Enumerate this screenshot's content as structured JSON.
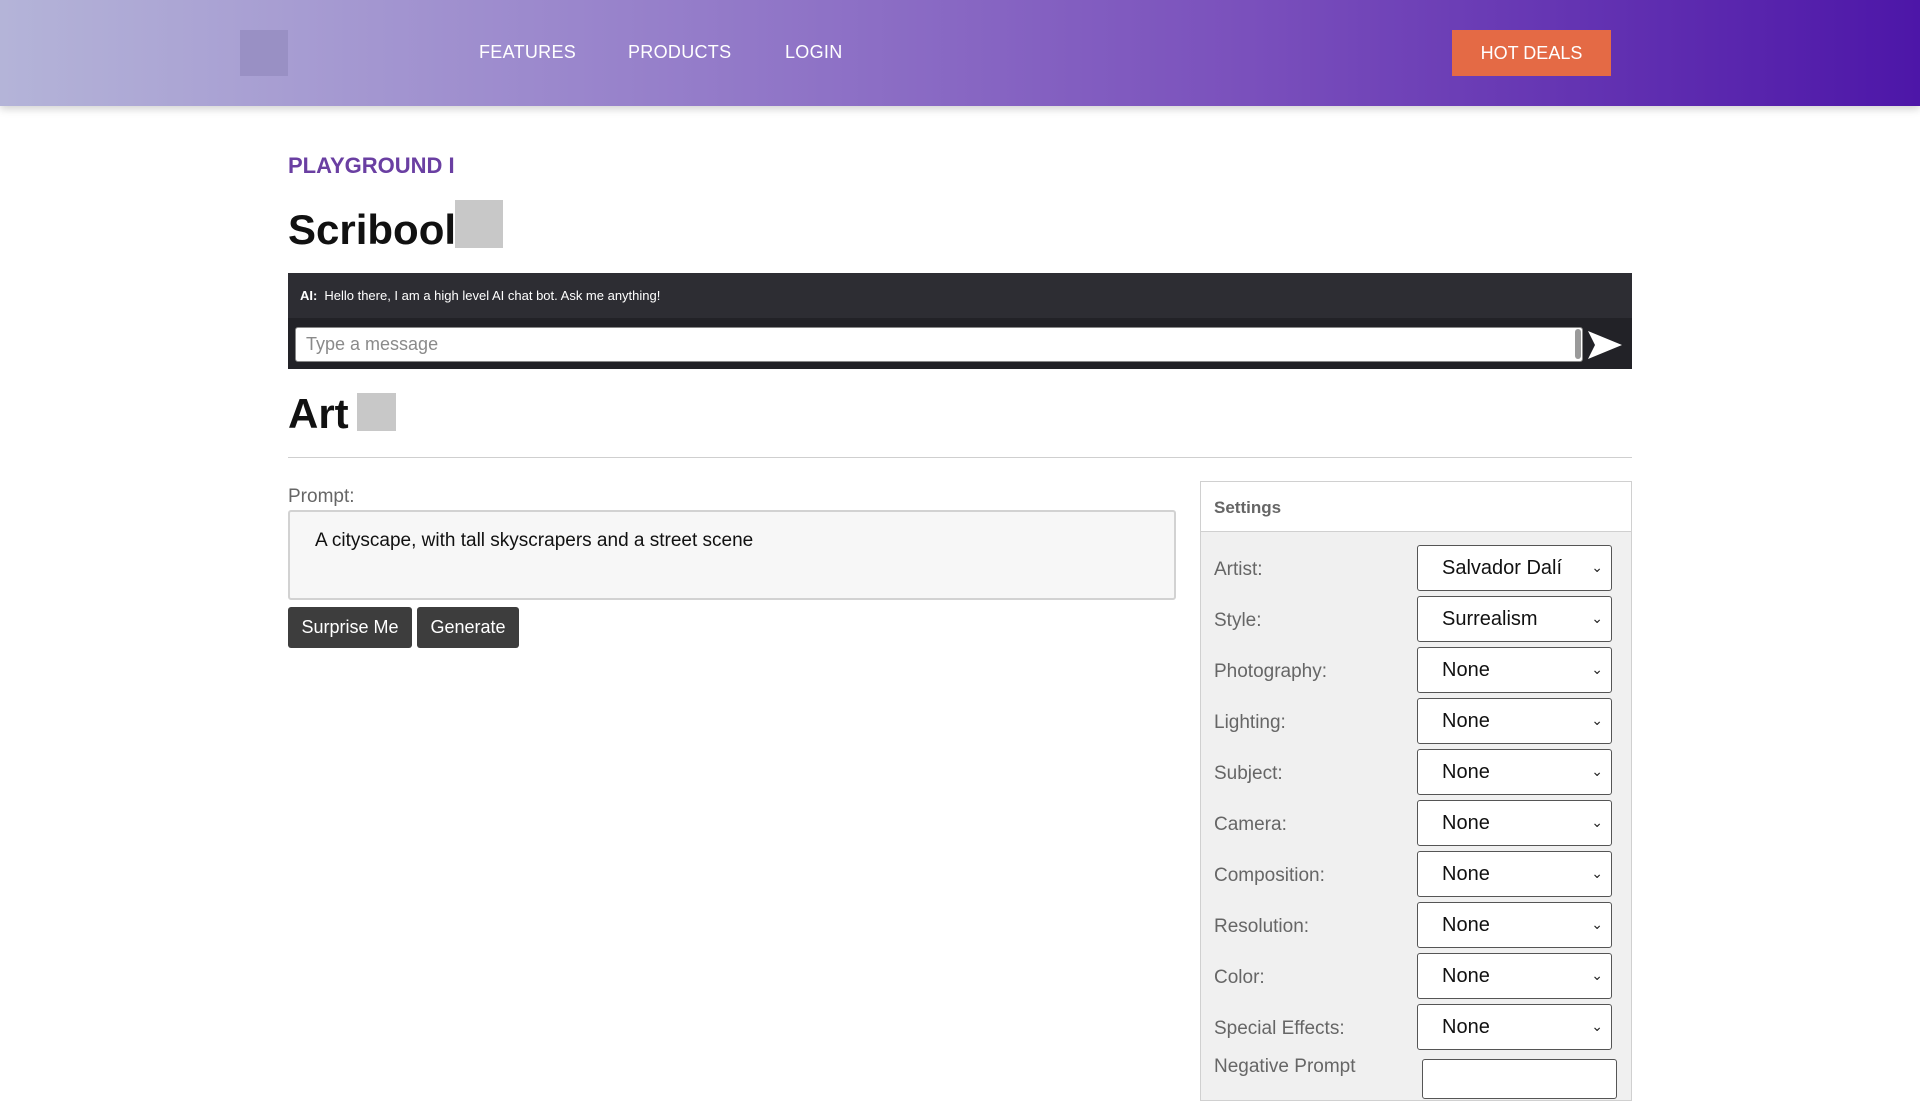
{
  "header": {
    "nav": [
      "FEATURES",
      "PRODUCTS",
      "LOGIN"
    ],
    "cta_label": "HOT DEALS"
  },
  "page": {
    "eyebrow": "PLAYGROUND I",
    "title": "Scribool",
    "art_title": "Art"
  },
  "chat": {
    "sender": "AI:",
    "message": "Hello there, I am a high level AI chat bot. Ask me anything!",
    "placeholder": "Type a message"
  },
  "prompt": {
    "label": "Prompt:",
    "value": "A cityscape, with tall skyscrapers and a street scene",
    "surprise_label": "Surprise Me",
    "generate_label": "Generate"
  },
  "settings": {
    "title": "Settings",
    "rows": [
      {
        "label": "Artist:",
        "value": "Salvador Dalí"
      },
      {
        "label": "Style:",
        "value": "Surrealism"
      },
      {
        "label": "Photography:",
        "value": "None"
      },
      {
        "label": "Lighting:",
        "value": "None"
      },
      {
        "label": "Subject:",
        "value": "None"
      },
      {
        "label": "Camera:",
        "value": "None"
      },
      {
        "label": "Composition:",
        "value": "None"
      },
      {
        "label": "Resolution:",
        "value": "None"
      },
      {
        "label": "Color:",
        "value": "None"
      },
      {
        "label": "Special Effects:",
        "value": "None"
      }
    ],
    "negative_label": "Negative Prompt"
  }
}
